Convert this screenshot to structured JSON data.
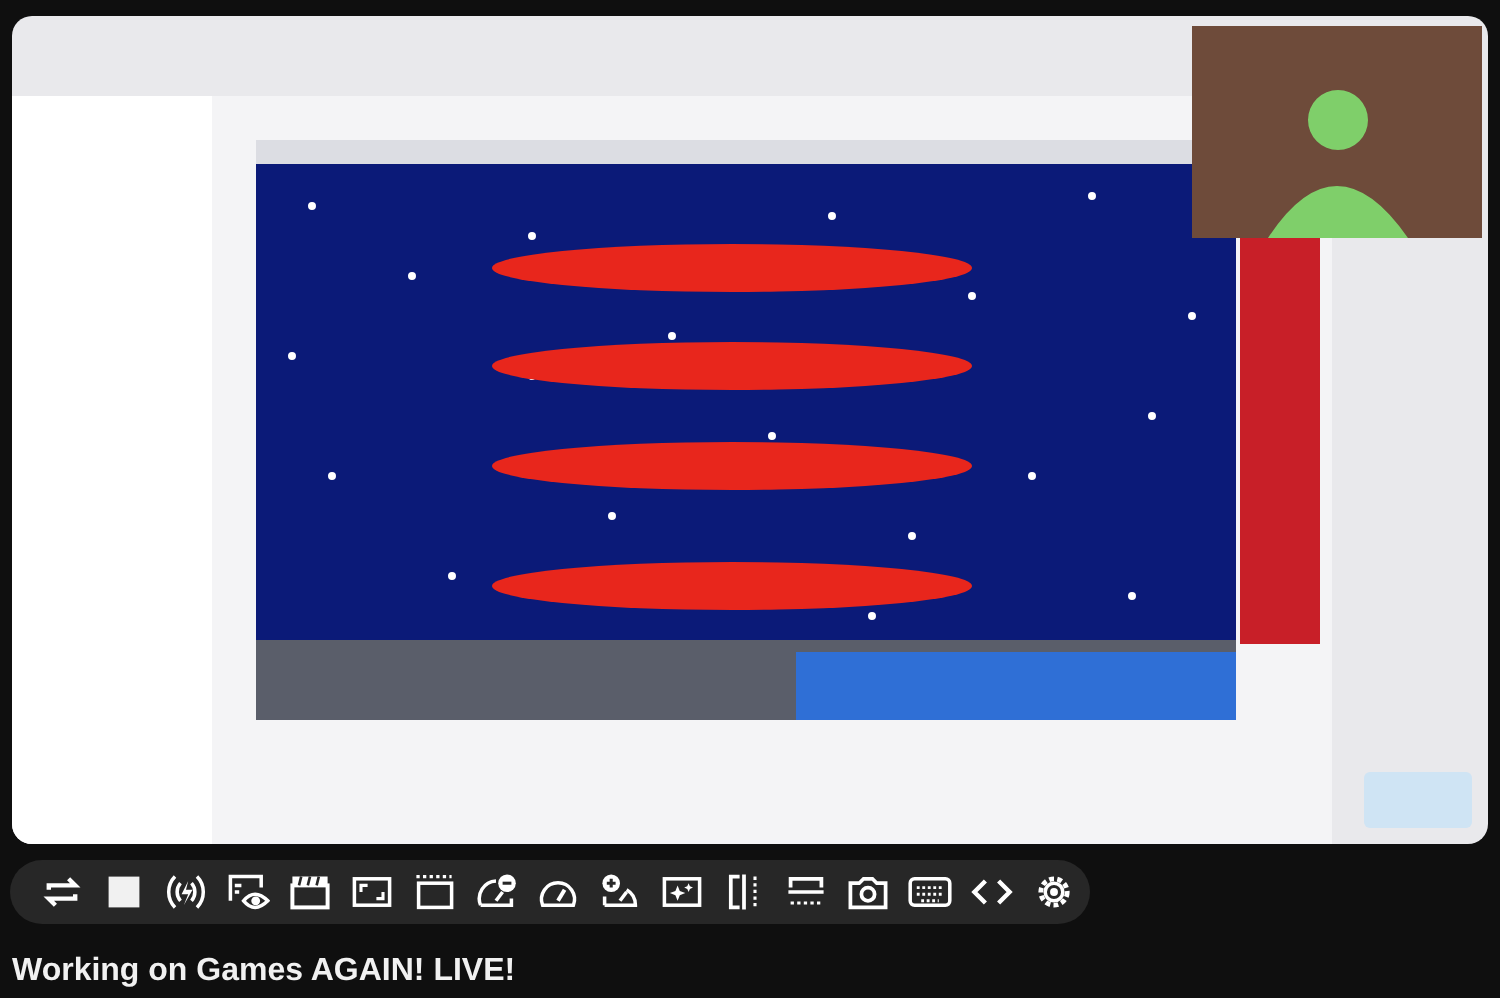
{
  "video_title": "Working on Games AGAIN! LIVE!"
}
